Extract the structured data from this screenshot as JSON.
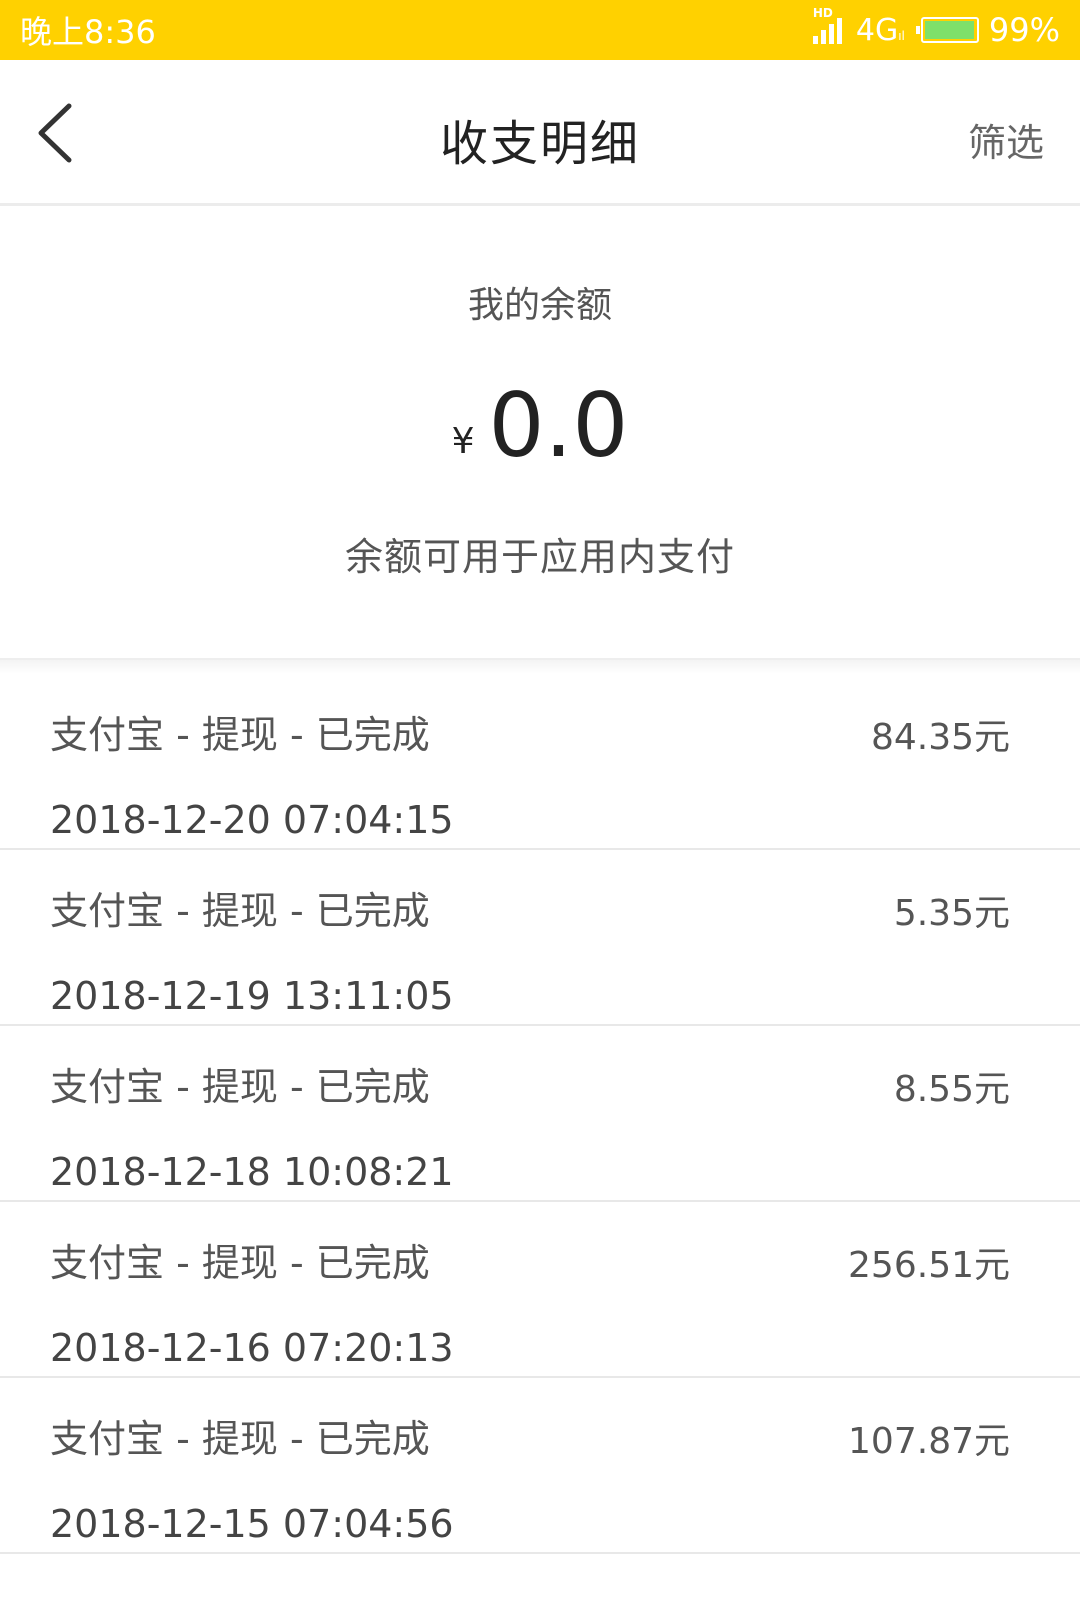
{
  "status_bar": {
    "time": "晚上8:36",
    "hd": "HD",
    "network": "4G",
    "battery": "99%",
    "battery_level": 0.99
  },
  "header": {
    "title": "收支明细",
    "filter_label": "筛选"
  },
  "balance": {
    "label": "我的余额",
    "currency": "¥",
    "amount": "0.0",
    "note": "余额可用于应用内支付"
  },
  "transactions": [
    {
      "desc": "支付宝 - 提现 - 已完成",
      "amount": "84.35元",
      "time": "2018-12-20 07:04:15"
    },
    {
      "desc": "支付宝 - 提现 - 已完成",
      "amount": "5.35元",
      "time": "2018-12-19 13:11:05"
    },
    {
      "desc": "支付宝 - 提现 - 已完成",
      "amount": "8.55元",
      "time": "2018-12-18 10:08:21"
    },
    {
      "desc": "支付宝 - 提现 - 已完成",
      "amount": "256.51元",
      "time": "2018-12-16 07:20:13"
    },
    {
      "desc": "支付宝 - 提现 - 已完成",
      "amount": "107.87元",
      "time": "2018-12-15 07:04:56"
    }
  ],
  "colors": {
    "status_bar": "#ffd100",
    "text_primary": "#222222",
    "text_secondary": "#555555"
  }
}
